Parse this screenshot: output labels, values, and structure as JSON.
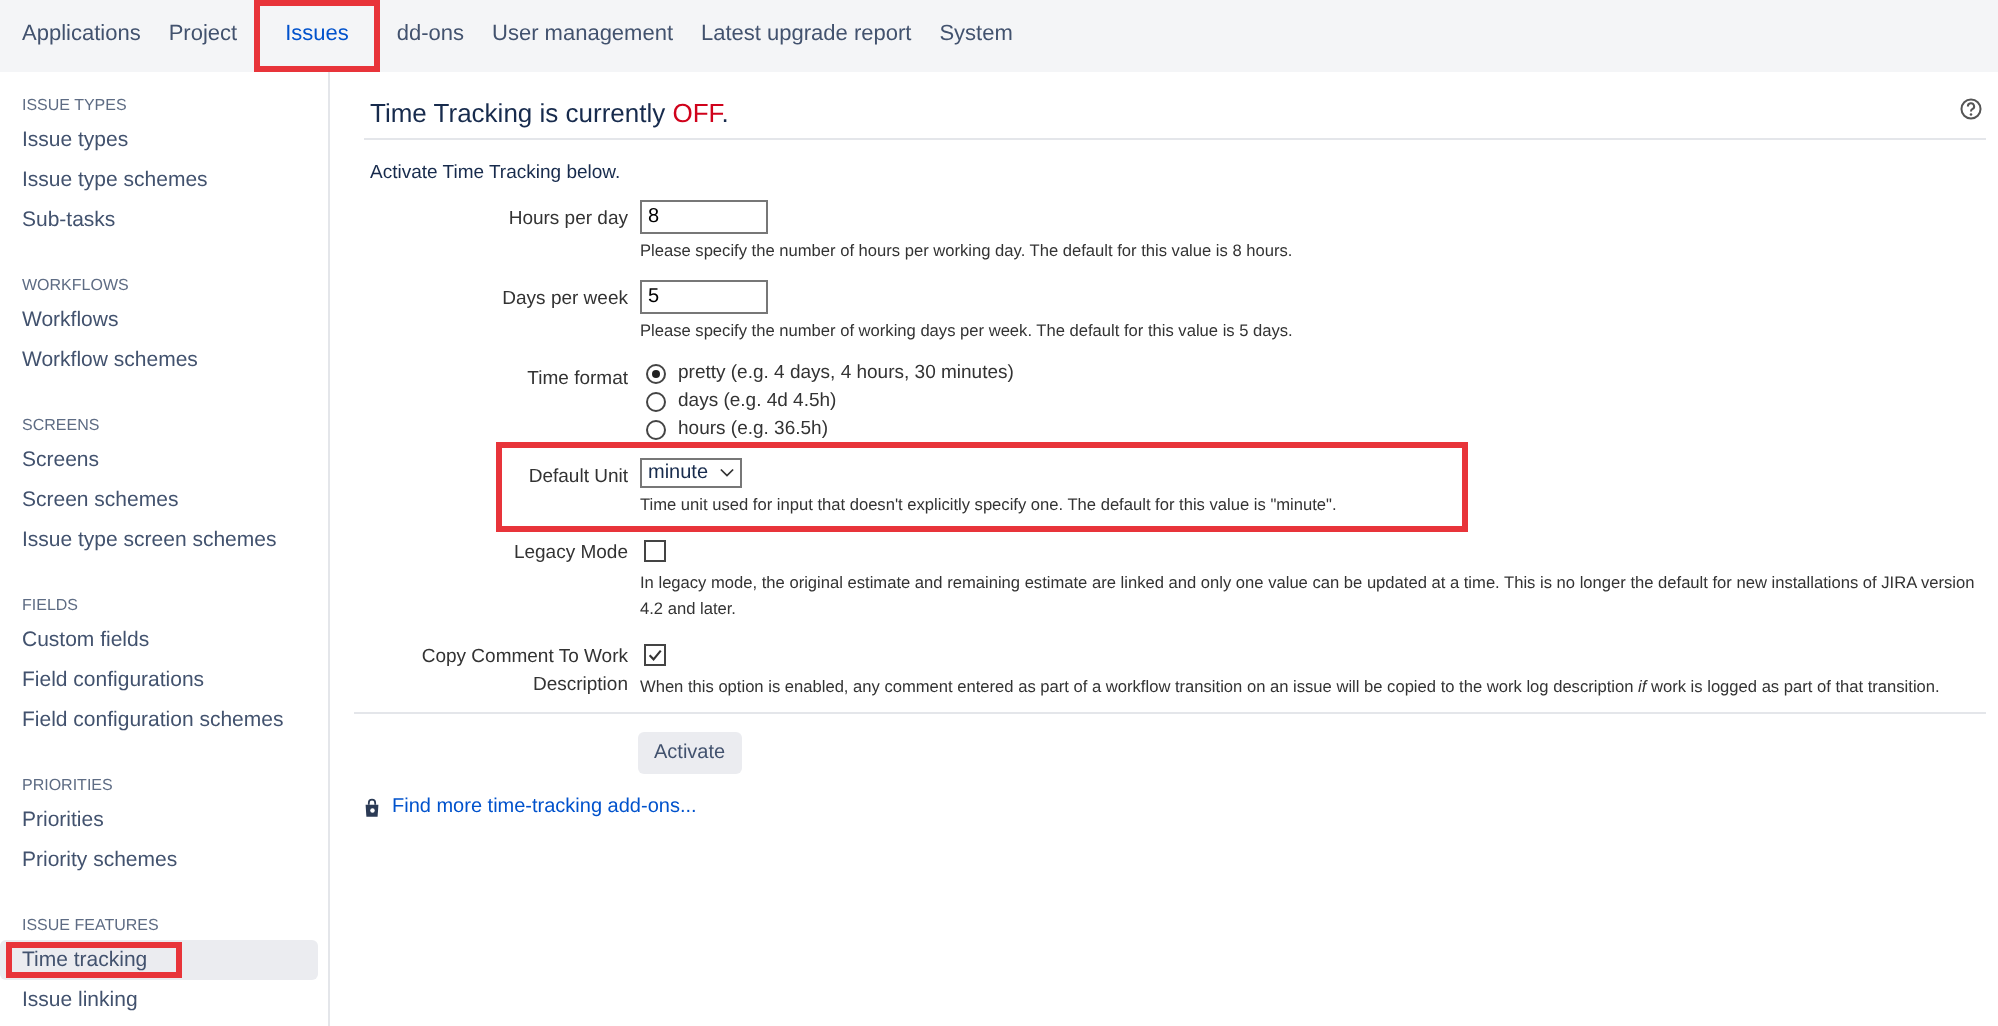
{
  "nav_tabs": [
    {
      "label": "Applications",
      "selected": false,
      "highlighted": false
    },
    {
      "label": "Project",
      "selected": false,
      "highlighted": false
    },
    {
      "label": "Issues",
      "selected": true,
      "highlighted": true
    },
    {
      "label": "dd-ons",
      "selected": false,
      "highlighted": false
    },
    {
      "label": "User management",
      "selected": false,
      "highlighted": false
    },
    {
      "label": "Latest upgrade report",
      "selected": false,
      "highlighted": false
    },
    {
      "label": "System",
      "selected": false,
      "highlighted": false
    }
  ],
  "sidebar": {
    "sections": [
      {
        "heading": "ISSUE TYPES",
        "items": [
          {
            "label": "Issue types",
            "selected": false,
            "highlighted": false
          },
          {
            "label": "Issue type schemes",
            "selected": false,
            "highlighted": false
          },
          {
            "label": "Sub-tasks",
            "selected": false,
            "highlighted": false
          }
        ]
      },
      {
        "heading": "WORKFLOWS",
        "items": [
          {
            "label": "Workflows",
            "selected": false,
            "highlighted": false
          },
          {
            "label": "Workflow schemes",
            "selected": false,
            "highlighted": false
          }
        ]
      },
      {
        "heading": "SCREENS",
        "items": [
          {
            "label": "Screens",
            "selected": false,
            "highlighted": false
          },
          {
            "label": "Screen schemes",
            "selected": false,
            "highlighted": false
          },
          {
            "label": "Issue type screen schemes",
            "selected": false,
            "highlighted": false
          }
        ]
      },
      {
        "heading": "FIELDS",
        "items": [
          {
            "label": "Custom fields",
            "selected": false,
            "highlighted": false
          },
          {
            "label": "Field configurations",
            "selected": false,
            "highlighted": false
          },
          {
            "label": "Field configuration schemes",
            "selected": false,
            "highlighted": false
          }
        ]
      },
      {
        "heading": "PRIORITIES",
        "items": [
          {
            "label": "Priorities",
            "selected": false,
            "highlighted": false
          },
          {
            "label": "Priority schemes",
            "selected": false,
            "highlighted": false
          }
        ]
      },
      {
        "heading": "ISSUE FEATURES",
        "items": [
          {
            "label": "Time tracking",
            "selected": true,
            "highlighted": true
          },
          {
            "label": "Issue linking",
            "selected": false,
            "highlighted": false
          }
        ]
      }
    ]
  },
  "page": {
    "title_lead": "Time Tracking is currently ",
    "status_text": "OFF",
    "status_on": false,
    "title_end": ".",
    "intro": "Activate Time Tracking below.",
    "fields": [
      {
        "kind": "text",
        "label": "Hours per day",
        "value": "8",
        "hint": "Please specify the number of hours per working day. The default for this value is 8 hours.",
        "highlighted": false
      },
      {
        "kind": "text",
        "label": "Days per week",
        "value": "5",
        "hint": "Please specify the number of working days per week. The default for this value is 5 days.",
        "highlighted": false
      },
      {
        "kind": "radio",
        "label": "Time format",
        "options": [
          {
            "label": "pretty (e.g. 4 days, 4 hours, 30 minutes)",
            "selected": true
          },
          {
            "label": "days (e.g. 4d 4.5h)",
            "selected": false
          },
          {
            "label": "hours (e.g. 36.5h)",
            "selected": false
          }
        ],
        "highlighted": false
      },
      {
        "kind": "select",
        "label": "Default Unit",
        "value": "minute",
        "hint": "Time unit used for input that doesn't explicitly specify one. The default for this value is \"minute\".",
        "highlighted": true
      },
      {
        "kind": "checkbox",
        "label": "Legacy Mode",
        "checked": false,
        "hint": "In legacy mode, the original estimate and remaining estimate are linked and only one value can be updated at a time. This is no longer the default for new installations of JIRA version 4.2 and later.",
        "highlighted": false
      },
      {
        "kind": "checkbox",
        "label": "Copy Comment To Work Description",
        "checked": true,
        "hint": "When this option is enabled, any comment entered as part of a workflow transition on an issue will be copied to the work log description *if* work is logged as part of that transition.",
        "highlighted": false
      }
    ],
    "button": "Activate",
    "link": "Find more time-tracking add-ons..."
  }
}
